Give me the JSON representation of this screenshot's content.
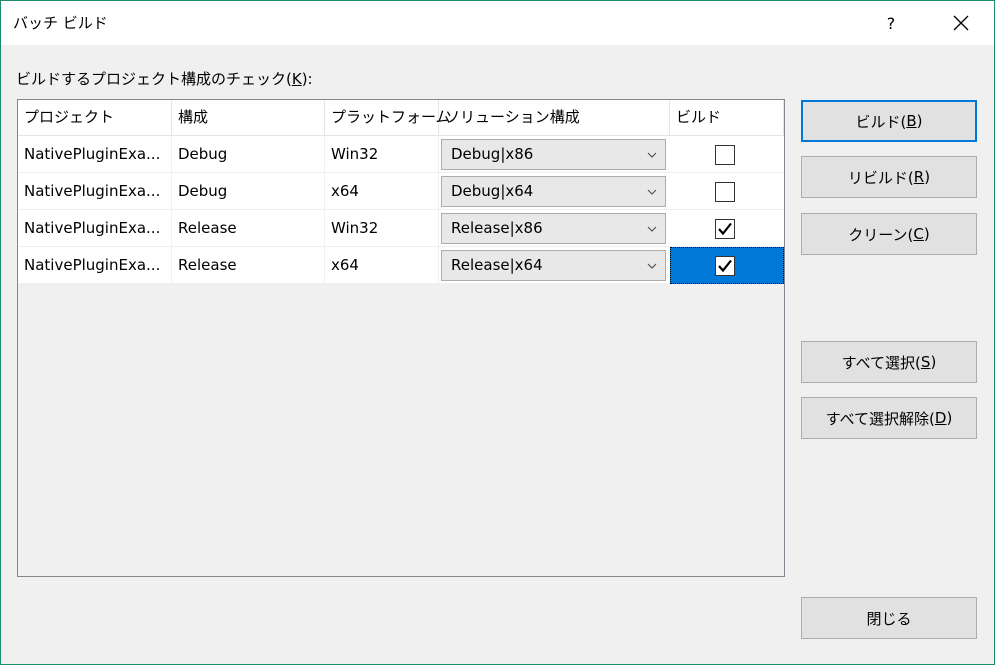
{
  "window": {
    "title": "バッチ ビルド",
    "help_label": "?"
  },
  "prompt": {
    "text": "ビルドするプロジェクト構成のチェック(",
    "key": "K",
    "suffix": "):"
  },
  "table": {
    "headers": [
      "プロジェクト",
      "構成",
      "プラットフォーム",
      "ソリューション構成",
      "ビルド"
    ],
    "rows": [
      {
        "project": "NativePluginExa...",
        "config": "Debug",
        "platform": "Win32",
        "solution_config": "Debug|x86",
        "build": false
      },
      {
        "project": "NativePluginExa...",
        "config": "Debug",
        "platform": "x64",
        "solution_config": "Debug|x64",
        "build": false
      },
      {
        "project": "NativePluginExa...",
        "config": "Release",
        "platform": "Win32",
        "solution_config": "Release|x86",
        "build": true
      },
      {
        "project": "NativePluginExa...",
        "config": "Release",
        "platform": "x64",
        "solution_config": "Release|x64",
        "build": true
      }
    ]
  },
  "buttons": {
    "build": {
      "label": "ビルド(",
      "key": "B",
      "suffix": ")"
    },
    "rebuild": {
      "label": "リビルド(",
      "key": "R",
      "suffix": ")"
    },
    "clean": {
      "label": "クリーン(",
      "key": "C",
      "suffix": ")"
    },
    "select_all": {
      "label": "すべて選択(",
      "key": "S",
      "suffix": ")"
    },
    "deselect_all": {
      "label": "すべて選択解除(",
      "key": "D",
      "suffix": ")"
    },
    "close": {
      "label": "閉じる"
    }
  },
  "icons": {
    "help": "help-icon",
    "close": "close-icon",
    "dropdown": "chevron-down-icon",
    "check": "check-icon"
  },
  "colors": {
    "selection": "#0078d7",
    "frame": "#1f8a70"
  }
}
